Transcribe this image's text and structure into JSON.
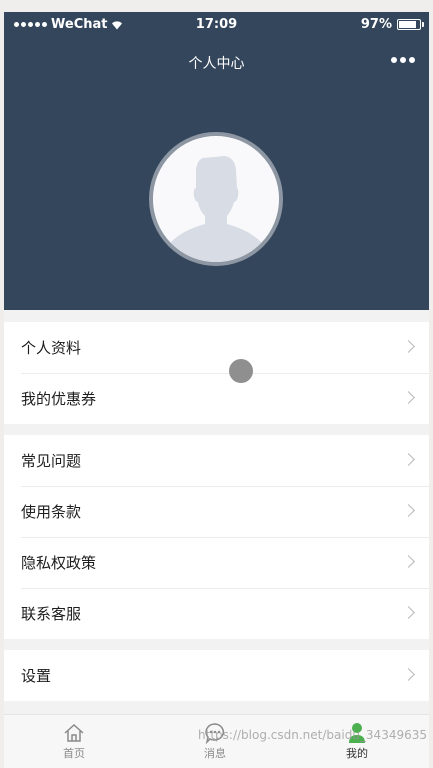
{
  "status_bar": {
    "carrier": "WeChat",
    "time": "17:09",
    "battery": "97%",
    "battery_level": 0.97
  },
  "nav": {
    "title": "个人中心"
  },
  "menu_groups": [
    {
      "items": [
        {
          "label": "个人资料"
        },
        {
          "label": "我的优惠券"
        }
      ]
    },
    {
      "items": [
        {
          "label": "常见问题"
        },
        {
          "label": "使用条款"
        },
        {
          "label": "隐私权政策"
        },
        {
          "label": "联系客服"
        }
      ]
    },
    {
      "items": [
        {
          "label": "设置"
        }
      ]
    }
  ],
  "tabbar": {
    "home": "首页",
    "messages": "消息",
    "mine": "我的",
    "active_color": "#4caf50"
  },
  "watermark": "https://blog.csdn.net/baidu_34349635",
  "colors": {
    "header_bg": "#34465c",
    "page_bg": "#f2f2f2"
  }
}
